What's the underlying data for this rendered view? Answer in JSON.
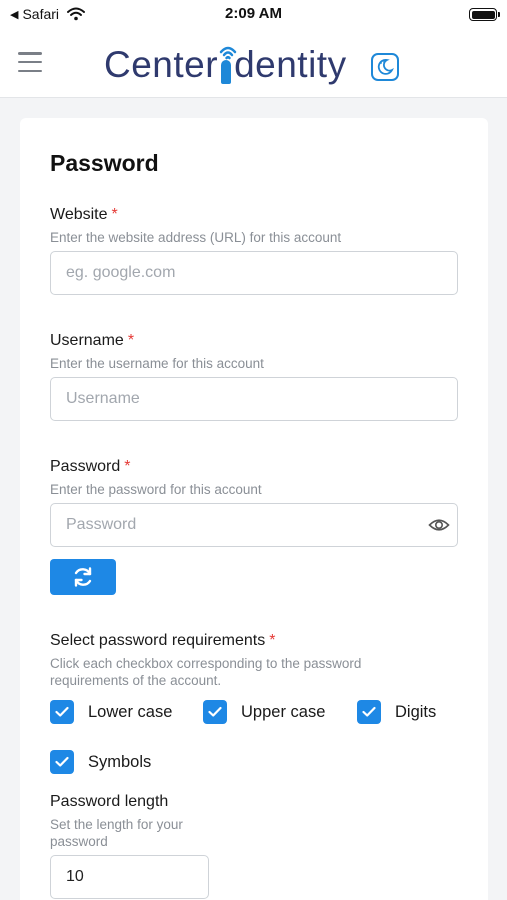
{
  "status_bar": {
    "back_app": "Safari",
    "time": "2:09 AM"
  },
  "header": {
    "logo_text_left": "Center",
    "logo_text_right": "dentity"
  },
  "form": {
    "title": "Password",
    "website": {
      "label": "Website",
      "required_mark": "*",
      "help": "Enter the website address (URL) for this account",
      "placeholder": "eg. google.com",
      "value": ""
    },
    "username": {
      "label": "Username",
      "required_mark": "*",
      "help": "Enter the username for this account",
      "placeholder": "Username",
      "value": ""
    },
    "password": {
      "label": "Password",
      "required_mark": "*",
      "help": "Enter the password for this account",
      "placeholder": "Password",
      "value": ""
    },
    "requirements": {
      "label": "Select password requirements",
      "required_mark": "*",
      "help_line1": "Click each checkbox corresponding to the password",
      "help_line2": "requirements of the account.",
      "options": [
        {
          "label": "Lower case",
          "checked": true
        },
        {
          "label": "Upper case",
          "checked": true
        },
        {
          "label": "Digits",
          "checked": true
        },
        {
          "label": "Symbols",
          "checked": true
        }
      ]
    },
    "length": {
      "label": "Password length",
      "help_line1": "Set the length for your",
      "help_line2": "password",
      "value": "10"
    }
  },
  "colors": {
    "accent": "#1e88e5",
    "logo_text": "#2f3a6e",
    "required": "#e53935"
  },
  "icons": {
    "menu": "hamburger-icon",
    "theme": "moon-theme-icon",
    "show_password": "eye-icon",
    "regenerate": "refresh-icon",
    "check": "checkmark-icon"
  }
}
